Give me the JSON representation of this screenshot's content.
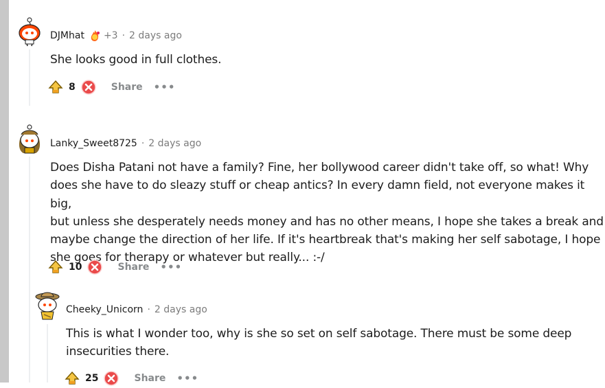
{
  "comments": [
    {
      "username": "DJMhat",
      "flair_icon": "fire-flair-icon",
      "extra": "+3",
      "separator": "·",
      "time": "2 days ago",
      "body": "She looks good in full clothes.",
      "score": "8",
      "share_label": "Share",
      "more_label": "•••"
    },
    {
      "username": "Lanky_Sweet8725",
      "separator": "·",
      "time": "2 days ago",
      "body": "Does Disha Patani not have a family? Fine, her bollywood career didn't take off, so what! Why\ndoes she have to do sleazy stuff or cheap antics? In every damn field, not everyone makes it big,\nbut unless she desperately needs money and has no other means, I hope she takes a break and\nmaybe change the direction of her life. If it's heartbreak that's making her self sabotage, I hope\nshe goes for therapy or whatever but really... :-/",
      "score": "10",
      "share_label": "Share",
      "more_label": "•••"
    },
    {
      "username": "Cheeky_Unicorn",
      "separator": "·",
      "time": "2 days ago",
      "body": "This is what I wonder too, why is she so set on self sabotage. There must be some deep\ninsecurities there.",
      "score": "25",
      "share_label": "Share",
      "more_label": "•••"
    }
  ],
  "colors": {
    "upvote_fill": "#f5c542",
    "downvote_fill": "#ea4a4a",
    "meta_gray": "#7c7c7c",
    "action_gray": "#878a8c"
  }
}
